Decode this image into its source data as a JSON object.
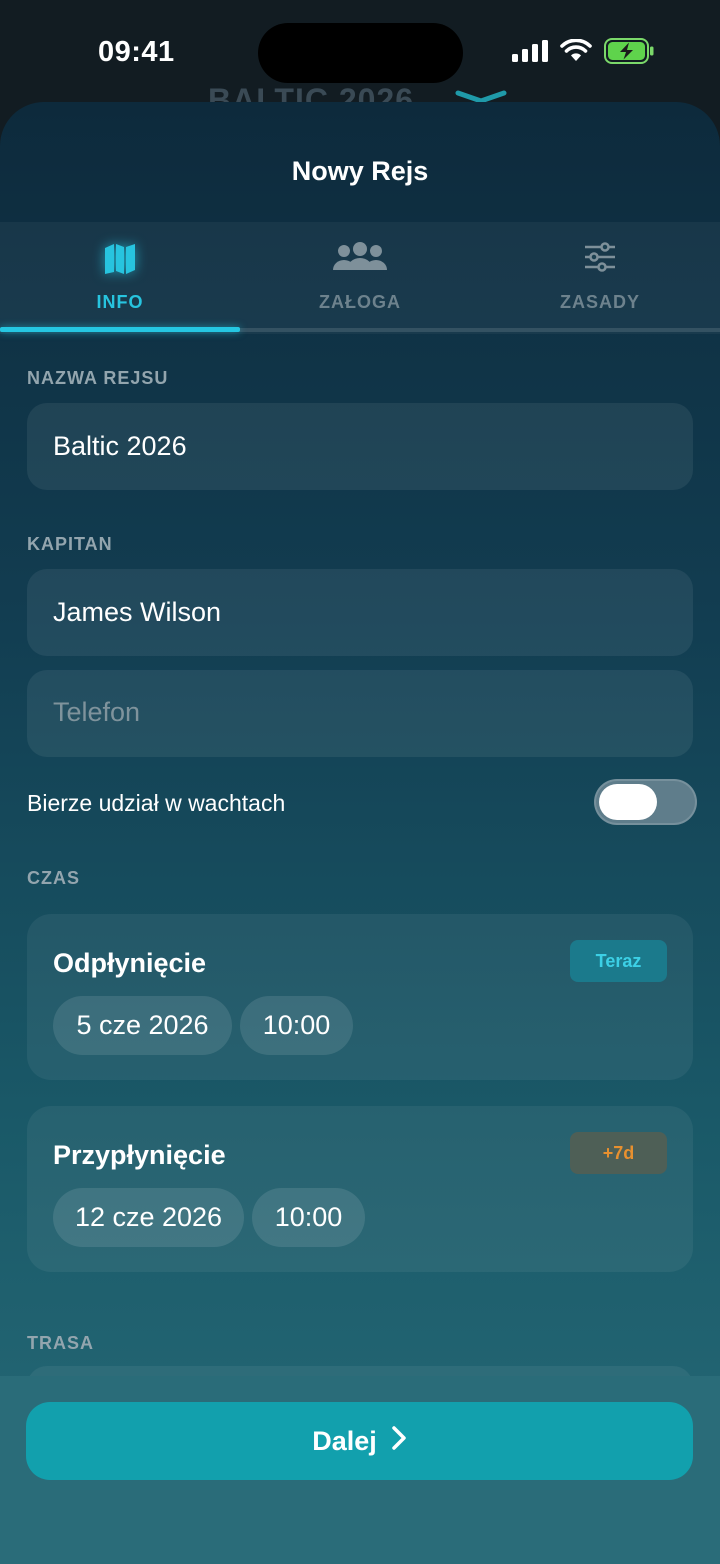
{
  "status_bar": {
    "time": "09:41"
  },
  "background": {
    "title": "BALTIC 2026"
  },
  "header": {
    "title": "Nowy Rejs"
  },
  "tabs": [
    {
      "label": "INFO",
      "icon": "map-icon",
      "active": true
    },
    {
      "label": "ZAŁOGA",
      "icon": "users-icon",
      "active": false
    },
    {
      "label": "ZASADY",
      "icon": "sliders-icon",
      "active": false
    }
  ],
  "form": {
    "name_section": "NAZWA REJSU",
    "name_value": "Baltic 2026",
    "captain_section": "KAPITAN",
    "captain_value": "James Wilson",
    "phone_placeholder": "Telefon",
    "watch_toggle_label": "Bierze udział w wachtach",
    "watch_toggle_on": false,
    "time_section": "CZAS",
    "route_section": "TRASA"
  },
  "departure": {
    "title": "Odpłynięcie",
    "badge": "Teraz",
    "date": "5 cze 2026",
    "time": "10:00"
  },
  "arrival": {
    "title": "Przypłynięcie",
    "badge": "+7d",
    "date": "12 cze 2026",
    "time": "10:00"
  },
  "footer": {
    "next_label": "Dalej"
  },
  "colors": {
    "accent": "#25c7e2",
    "button": "#12a0ad",
    "badge_orange": "#e8902f"
  }
}
